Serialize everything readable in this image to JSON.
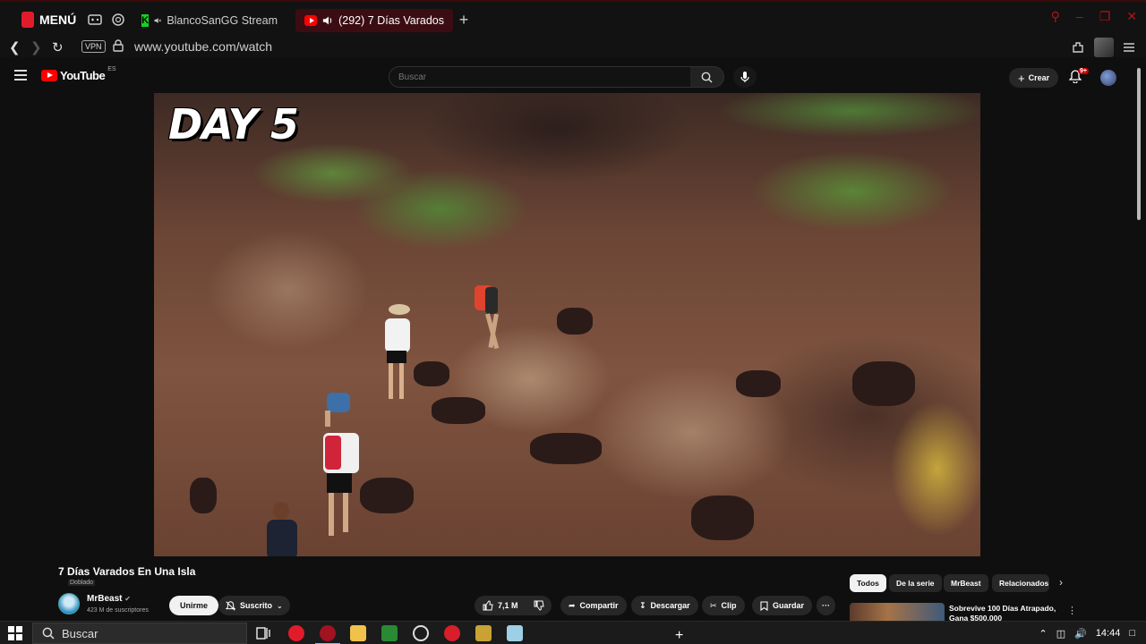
{
  "browser": {
    "menu_label": "MENÚ",
    "tabs": [
      {
        "label": "BlancoSanGG Stream",
        "muted": true
      },
      {
        "label": "(292) 7 Días Varados",
        "audio": true,
        "active": true
      }
    ],
    "new_tab": "+",
    "url": "www.youtube.com/watch",
    "vpn_label": "VPN"
  },
  "youtube": {
    "logo_text": "YouTube",
    "country_code": "ES",
    "search_placeholder": "Buscar",
    "create_label": "Crear",
    "notif_count": "9+"
  },
  "player": {
    "overlay_text": "DAY 5"
  },
  "video": {
    "title": "7 Días Varados En Una Isla",
    "dubbed_label": "Doblado",
    "channel": "MrBeast",
    "subscribers": "423 M de suscriptores",
    "join_label": "Unirme",
    "subscribed_label": "Suscrito",
    "likes": "7,1 M",
    "share_label": "Compartir",
    "download_label": "Descargar",
    "clip_label": "Clip",
    "save_label": "Guardar",
    "more_label": "···"
  },
  "sidebar": {
    "chips": [
      {
        "label": "Todos",
        "active": true
      },
      {
        "label": "De la serie"
      },
      {
        "label": "MrBeast"
      },
      {
        "label": "Relacionados"
      }
    ],
    "recommendation_title": "Sobrevive 100 Días Atrapado, Gana $500.000"
  },
  "taskbar": {
    "search_placeholder": "Buscar",
    "time": "14:44"
  },
  "colors": {
    "accent_red": "#ff0000",
    "opera_red": "#e21b2b",
    "active_tab_bg": "#3b0d12",
    "background": "#0f0f0f"
  }
}
